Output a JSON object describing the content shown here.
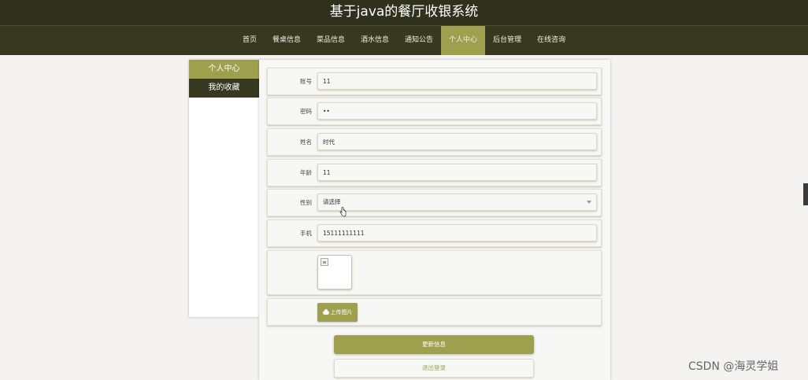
{
  "header": {
    "title": "基于java的餐厅收银系统"
  },
  "nav": {
    "items": [
      {
        "label": "首页",
        "active": false
      },
      {
        "label": "餐桌信息",
        "active": false
      },
      {
        "label": "菜品信息",
        "active": false
      },
      {
        "label": "酒水信息",
        "active": false
      },
      {
        "label": "通知公告",
        "active": false
      },
      {
        "label": "个人中心",
        "active": true
      },
      {
        "label": "后台管理",
        "active": false
      },
      {
        "label": "在线咨询",
        "active": false
      }
    ]
  },
  "sidebar": {
    "items": [
      {
        "label": "个人中心",
        "active": true
      },
      {
        "label": "我的收藏",
        "active": false
      }
    ]
  },
  "form": {
    "account": {
      "label": "账号",
      "value": "11"
    },
    "password": {
      "label": "密码",
      "value": "••"
    },
    "name": {
      "label": "姓名",
      "value": "时代"
    },
    "age": {
      "label": "年龄",
      "value": "11"
    },
    "gender": {
      "label": "性别",
      "value": "请选择"
    },
    "phone": {
      "label": "手机",
      "value": "15111111111"
    },
    "upload_label": "上传图片",
    "update_label": "更新信息",
    "logout_label": "退出登录"
  },
  "watermark": "CSDN @海灵学姐",
  "colors": {
    "header_bg": "#2f311c",
    "nav_bg": "#36381f",
    "accent": "#9ea04d"
  }
}
